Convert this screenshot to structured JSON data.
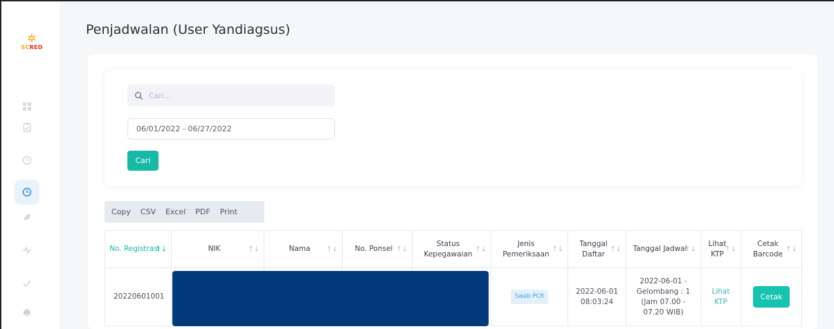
{
  "app": {
    "logo_text_a": "SC",
    "logo_text_b": "RED",
    "logo_star": "✲"
  },
  "page": {
    "title": "Penjadwalan (User Yandiagsus)"
  },
  "filters": {
    "search_placeholder": "Cari...",
    "date_range": "06/01/2022 - 06/27/2022",
    "search_button": "Cari"
  },
  "export": {
    "buttons": [
      "Copy",
      "CSV",
      "Excel",
      "PDF",
      "Print"
    ]
  },
  "table": {
    "headers": [
      "No. Registrasi",
      "NIK",
      "Nama",
      "No. Ponsel",
      "Status Kepegawaian",
      "Jenis Pemeriksaan",
      "Tanggal Daftar",
      "Tanggal Jadwal",
      "Lihat KTP",
      "Cetak Barcode"
    ],
    "sort_glyph": "↑↓",
    "rows": [
      {
        "no_registrasi": "20220601001",
        "jenis_pemeriksaan": "Swab PCR",
        "tanggal_daftar": "2022-06-01 08:03:24",
        "tanggal_jadwal": "2022-06-01 - Gelombang : 1 (Jam 07.00 - 07.20 WIB)",
        "lihat_ktp": "Lihat KTP",
        "cetak": "Cetak"
      }
    ]
  },
  "colors": {
    "accent": "#16b9a6",
    "redaction": "#033a7b",
    "active_nav": "#2a8bd8"
  },
  "nav_icons": [
    "grid-icon",
    "clipboard-icon",
    "clock-icon",
    "clock-active-icon",
    "leaf-icon",
    "pulse-icon",
    "check-icon",
    "printer-icon"
  ]
}
